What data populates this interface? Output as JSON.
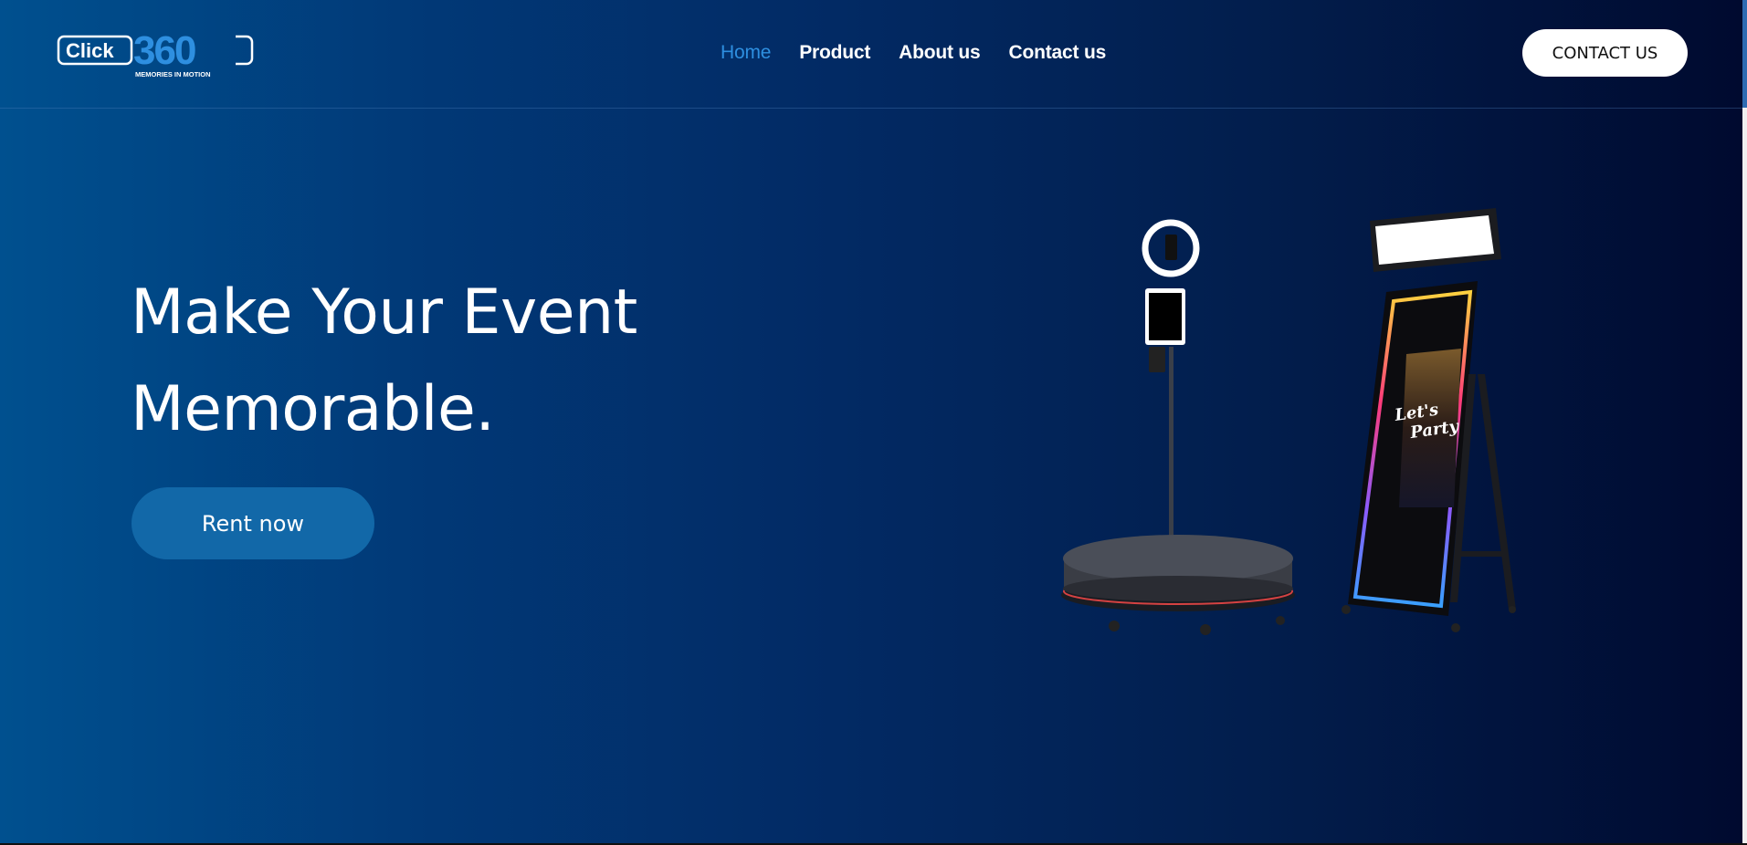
{
  "header": {
    "logo": {
      "word": "Click",
      "number": "360",
      "tagline": "MEMORIES IN MOTION"
    },
    "nav": [
      {
        "label": "Home",
        "active": true
      },
      {
        "label": "Product",
        "active": false
      },
      {
        "label": "About us",
        "active": false
      },
      {
        "label": "Contact us",
        "active": false
      }
    ],
    "contact_button": "CONTACT US"
  },
  "hero": {
    "title_line1": "Make Your Event",
    "title_line2": "Memorable.",
    "cta": "Rent now",
    "screen_text_1": "Let's",
    "screen_text_2": "Party"
  },
  "colors": {
    "accent": "#2e8fe0",
    "cta_bg": "#1268a8",
    "bg_left": "#00508f",
    "bg_right": "#000a2f"
  }
}
